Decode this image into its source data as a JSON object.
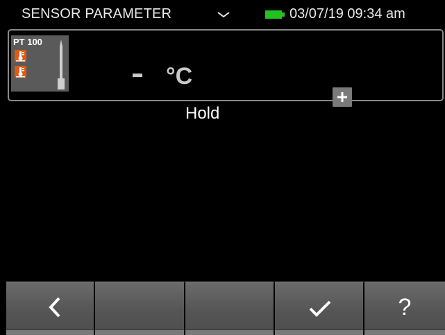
{
  "status_bar": {
    "title": "SENSOR PARAMETER",
    "menu_icon": "chevron-down-icon",
    "battery_icon": "battery-full-icon",
    "battery_color": "#22c222",
    "datetime": "03/07/19 09:34 am"
  },
  "sensor": {
    "probe_type": "PT 100",
    "value": "-",
    "unit": "°C",
    "status": "Hold",
    "add_icon": "plus-icon",
    "badge_color": "#e05a14"
  },
  "softkeys": [
    {
      "icon": "back-icon"
    },
    {
      "icon": ""
    },
    {
      "icon": ""
    },
    {
      "icon": "check-icon"
    },
    {
      "icon": "help-icon",
      "label": "?"
    }
  ]
}
